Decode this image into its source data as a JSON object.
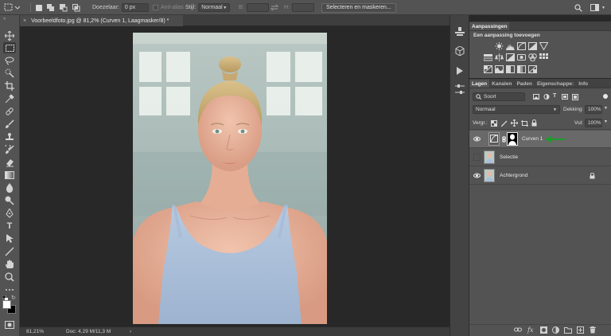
{
  "options": {
    "feather_label": "Doezelaar:",
    "feather_value": "0 px",
    "anti_alias_label": "Anti-alias",
    "style_label": "Stijl:",
    "style_value": "Normaal",
    "width_label": "B:",
    "height_label": "H:",
    "select_mask_button": "Selecteren en maskeren..."
  },
  "document": {
    "tab_title": "Voorbeeldfoto.jpg @ 81,2% (Curven 1, Laagmasker/8) *",
    "close_glyph": "×"
  },
  "status": {
    "zoom": "81,21%",
    "doc_info": "Doc: 4,29 M/11,3 M",
    "arrow": "›"
  },
  "adjustments": {
    "tab_label": "Aanpassingen",
    "subtitle": "Een aanpassing toevoegen"
  },
  "layers_panel": {
    "tabs": [
      "Lagen",
      "Kanalen",
      "Paden",
      "Eigenschappe:",
      "Info"
    ],
    "filter_label": "Soort",
    "blend_mode": "Normaal",
    "opacity_label": "Dekking:",
    "opacity_value": "100%",
    "lock_label": "Vergr.:",
    "fill_label": "Vul:",
    "fill_value": "100%",
    "layers": [
      {
        "name": "Curven 1",
        "visible": true
      },
      {
        "name": "Selectie",
        "visible": false
      },
      {
        "name": "Achtergrond",
        "visible": true,
        "locked": true
      }
    ]
  },
  "colors": {
    "accent_arrow": "#1e9a2e",
    "panel_bg": "#535353",
    "canvas_bg": "#282828"
  }
}
